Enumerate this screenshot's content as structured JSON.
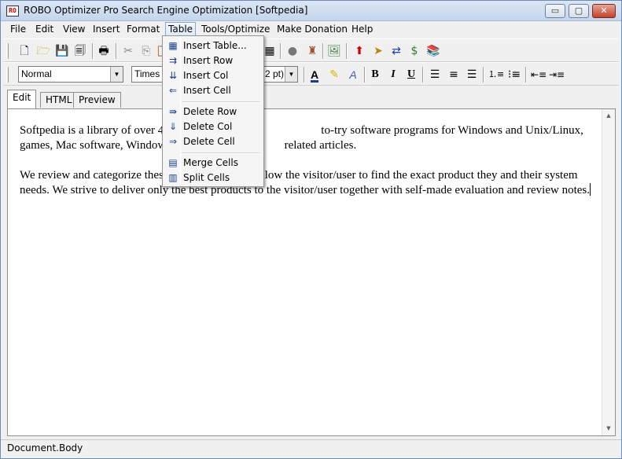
{
  "app": {
    "icon_text": "RO",
    "title": "ROBO Optimizer Pro Search Engine Optimization [Softpedia]"
  },
  "window_controls": {
    "minimize": "▭",
    "maximize": "▢",
    "close": "✕"
  },
  "menubar": {
    "items": [
      "File",
      "Edit",
      "View",
      "Insert",
      "Format",
      "Table",
      "Tools/Optimize",
      "Make Donation",
      "Help"
    ],
    "active": "Table"
  },
  "toolbar1": {
    "icons": [
      "new-document-icon",
      "open-folder-icon",
      "save-icon",
      "save-all-icon",
      "print-icon",
      "cut-icon",
      "copy-icon",
      "paste-icon",
      "table-grid-icon",
      "globe-icon",
      "seo-check-icon",
      "insert-image-icon",
      "upload-icon",
      "tag-icon",
      "compare-icon",
      "money-icon",
      "book-icon"
    ]
  },
  "toolbar2": {
    "style_select": "Normal",
    "font_select": "Times N",
    "size_select": "2 pt)",
    "format_buttons": [
      "B",
      "I",
      "U"
    ]
  },
  "tabs": [
    "Edit",
    "HTML",
    "Preview"
  ],
  "active_tab": "Edit",
  "editor": {
    "paragraph1": "Softpedia is a library of over 4...to-try software programs for Windows and Unix/Linux, games, Mac software, Windows drivers, m... related articles.",
    "p1_part1": "Softpedia is a library of over 4",
    "p1_part2": "to-try software programs for Windows and Unix/Linux, games, Mac",
    "p1_part3": "software, Windows drivers, m",
    "p1_part4": "related articles.",
    "p2_part1": "We review and categorize thes",
    "p2_part2": "allow the visitor/user to find the exact product they and their system",
    "p2_part3": "needs. We strive to deliver only the best products to the visitor/user together with self-made evaluation and review notes."
  },
  "status": {
    "text": "Document.Body"
  },
  "table_menu": {
    "group1": [
      {
        "label": "Insert Table...",
        "icon": "insert-table-icon"
      },
      {
        "label": "Insert Row",
        "icon": "insert-row-icon"
      },
      {
        "label": "Insert Col",
        "icon": "insert-col-icon"
      },
      {
        "label": "Insert Cell",
        "icon": "insert-cell-icon"
      }
    ],
    "group2": [
      {
        "label": "Delete Row",
        "icon": "delete-row-icon"
      },
      {
        "label": "Delete Col",
        "icon": "delete-col-icon"
      },
      {
        "label": "Delete Cell",
        "icon": "delete-cell-icon"
      }
    ],
    "group3": [
      {
        "label": "Merge Cells",
        "icon": "merge-cells-icon"
      },
      {
        "label": "Split Cells",
        "icon": "split-cells-icon"
      }
    ]
  }
}
